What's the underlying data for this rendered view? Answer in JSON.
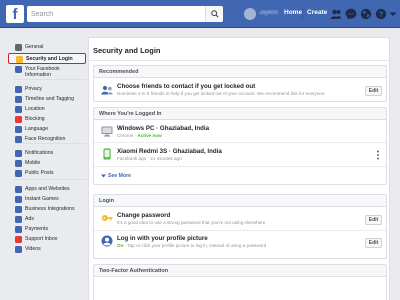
{
  "header": {
    "search_placeholder": "Search",
    "profile_name": "Jayesh",
    "nav": [
      "Home",
      "Create"
    ]
  },
  "sidebar": {
    "items": [
      {
        "label": "General",
        "icon": "gear-icon",
        "color": "#606770"
      },
      {
        "label": "Security and Login",
        "icon": "shield-icon",
        "color": "#f7b928"
      },
      {
        "label": "Your Facebook Information",
        "icon": "facebook-icon",
        "color": "#4267b2"
      },
      {
        "label": "Privacy",
        "icon": "lock-icon",
        "color": "#4267b2"
      },
      {
        "label": "Timeline and Tagging",
        "icon": "timeline-icon",
        "color": "#4267b2"
      },
      {
        "label": "Location",
        "icon": "location-icon",
        "color": "#4267b2"
      },
      {
        "label": "Blocking",
        "icon": "blocking-icon",
        "color": "#e9373b"
      },
      {
        "label": "Language",
        "icon": "language-icon",
        "color": "#4267b2"
      },
      {
        "label": "Face Recognition",
        "icon": "face-recognition-icon",
        "color": "#4267b2"
      },
      {
        "label": "Notifications",
        "icon": "globe-icon",
        "color": "#4267b2"
      },
      {
        "label": "Mobile",
        "icon": "mobile-icon",
        "color": "#4267b2"
      },
      {
        "label": "Public Posts",
        "icon": "public-posts-icon",
        "color": "#4267b2"
      },
      {
        "label": "Apps and Websites",
        "icon": "apps-icon",
        "color": "#4267b2"
      },
      {
        "label": "Instant Games",
        "icon": "games-icon",
        "color": "#4267b2"
      },
      {
        "label": "Business Integrations",
        "icon": "business-icon",
        "color": "#4267b2"
      },
      {
        "label": "Ads",
        "icon": "ads-icon",
        "color": "#4267b2"
      },
      {
        "label": "Payments",
        "icon": "payments-icon",
        "color": "#4267b2"
      },
      {
        "label": "Support Inbox",
        "icon": "support-icon",
        "color": "#e9373b"
      },
      {
        "label": "Videos",
        "icon": "videos-icon",
        "color": "#4267b2"
      }
    ]
  },
  "main": {
    "title": "Security and Login",
    "recommended": {
      "heading": "Recommended",
      "title": "Choose friends to contact if you get locked out",
      "subtitle": "Nominate 3 to 5 friends to help if you get locked out of your account. We recommend this for everyone.",
      "edit": "Edit"
    },
    "logged_in": {
      "heading": "Where You're Logged In",
      "sessions": [
        {
          "device": "Windows PC · Ghaziabad, India",
          "app": "Chrome",
          "status": "Active now"
        },
        {
          "device": "Xiaomi Redmi 3S · Ghaziabad, India",
          "app": "Facebook app",
          "status": "21 minutes ago"
        }
      ],
      "see_more": "See More"
    },
    "login": {
      "heading": "Login",
      "items": [
        {
          "title": "Change password",
          "subtitle": "It's a good idea to use a strong password that you're not using elsewhere",
          "edit": "Edit"
        },
        {
          "title": "Log in with your profile picture",
          "badge": "On",
          "subtitle": "Tap or click your profile picture to log in, instead of using a password",
          "edit": "Edit"
        }
      ]
    },
    "two_factor": {
      "heading": "Two-Factor Authentication"
    }
  }
}
